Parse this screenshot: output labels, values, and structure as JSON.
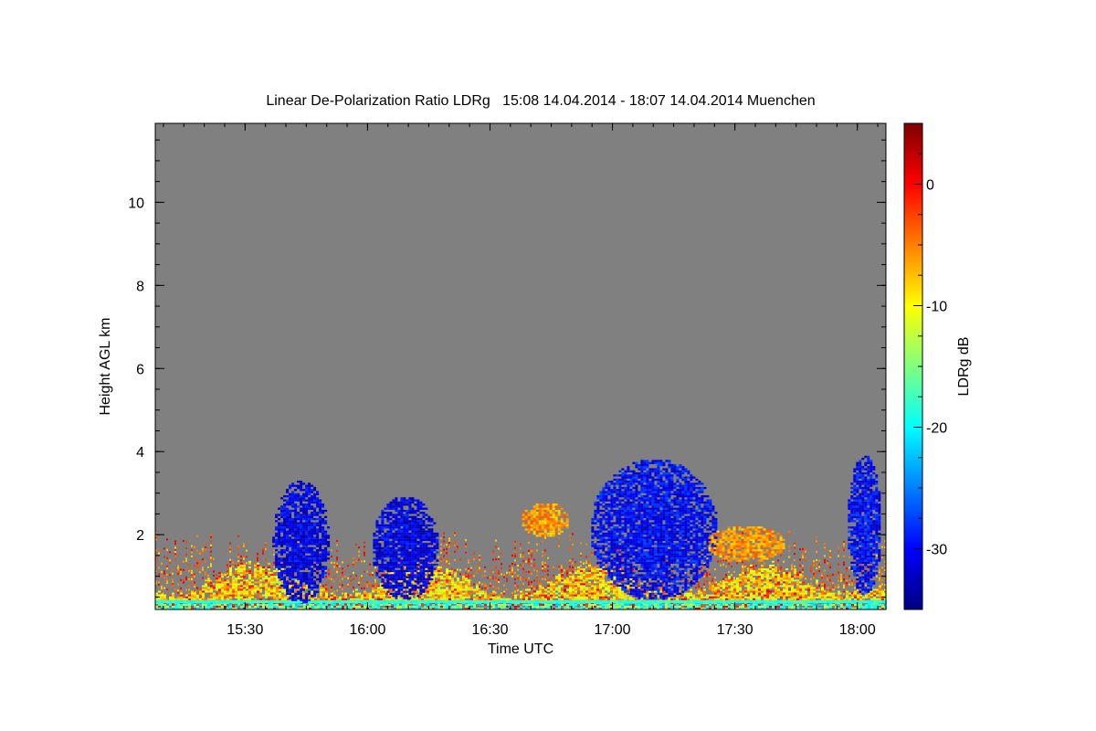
{
  "chart_data": {
    "type": "heatmap",
    "title": "Linear De-Polarization Ratio LDRg   15:08 14.04.2014 - 18:07 14.04.2014 Muenchen",
    "xlabel": "Time UTC",
    "ylabel": "Height AGL km",
    "x_ticks": [
      "15:30",
      "16:00",
      "16:30",
      "17:00",
      "17:30",
      "18:00"
    ],
    "y_ticks": [
      "2",
      "4",
      "6",
      "8",
      "10"
    ],
    "xlim": [
      "15:08",
      "18:07"
    ],
    "ylim": [
      0.2,
      11.9
    ],
    "colorbar": {
      "label": "LDRg dB",
      "range": [
        -35,
        5
      ],
      "ticks": [
        "0",
        "-10",
        "-20",
        "-30"
      ],
      "colors": [
        "#00007f",
        "#0000ff",
        "#0080ff",
        "#00ffff",
        "#80ff80",
        "#ffff00",
        "#ff8000",
        "#ff0000",
        "#7f0000"
      ]
    },
    "background_color": "#808080",
    "features": [
      {
        "kind": "blue_cloud",
        "t": [
          15.6,
          15.85
        ],
        "h": [
          0.3,
          3.3
        ],
        "ldr": -31
      },
      {
        "kind": "blue_cloud",
        "t": [
          16.0,
          16.3
        ],
        "h": [
          0.4,
          2.9
        ],
        "ldr": -31
      },
      {
        "kind": "orange_patch",
        "t": [
          16.62,
          16.82
        ],
        "h": [
          1.9,
          2.75
        ],
        "ldr": -6
      },
      {
        "kind": "blue_cloud",
        "t": [
          16.88,
          17.45
        ],
        "h": [
          0.4,
          3.8
        ],
        "ldr": -30
      },
      {
        "kind": "orange_patch",
        "t": [
          17.38,
          17.7
        ],
        "h": [
          1.3,
          2.2
        ],
        "ldr": -6
      },
      {
        "kind": "blue_cloud",
        "t": [
          17.95,
          18.1
        ],
        "h": [
          0.5,
          3.9
        ],
        "ldr": -30
      }
    ]
  }
}
